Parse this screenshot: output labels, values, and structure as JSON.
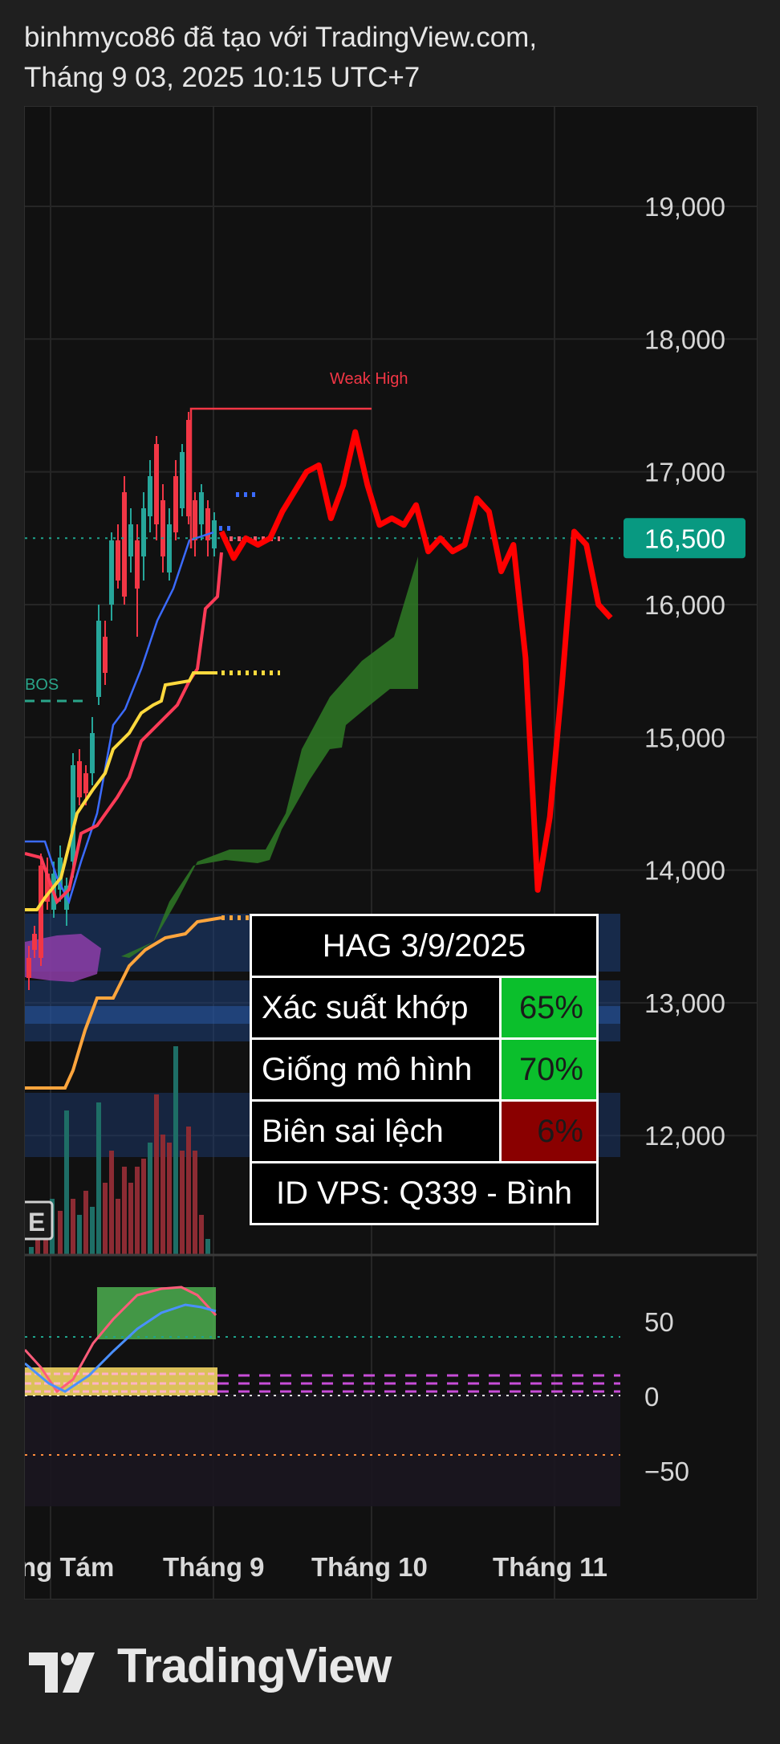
{
  "header": {
    "line1": "binhmyco86 đã tạo với TradingView.com,",
    "line2": "Tháng 9 03, 2025 10:15 UTC+7"
  },
  "chart_data": {
    "type": "line",
    "price_axis": {
      "ticks": [
        "19,000",
        "18,000",
        "17,000",
        "16,000",
        "15,000",
        "14,000",
        "13,000",
        "12,000"
      ],
      "ylim": [
        11100,
        19750
      ]
    },
    "current_price": {
      "label": "16,500",
      "value": 16500,
      "color": "#089981"
    },
    "x_axis": {
      "ticks": [
        "ng Tám",
        "Tháng 9",
        "Tháng 10",
        "Tháng 11"
      ]
    },
    "oscillator_axis": {
      "ticks": [
        "50",
        "0",
        "−50"
      ]
    },
    "annotations": {
      "weak_high": "Weak High",
      "bos": "BOS",
      "badge": "E"
    },
    "projection": {
      "color": "#ff0000",
      "values": [
        16550,
        16350,
        16500,
        16450,
        16500,
        16700,
        16850,
        17000,
        17050,
        16650,
        16900,
        17300,
        16900,
        16600,
        16650,
        16600,
        16750,
        16400,
        16500,
        16400,
        16450,
        16800,
        16700,
        16250,
        16450,
        15600,
        13850,
        14400,
        15400,
        16550,
        16450,
        16000,
        15900
      ]
    }
  },
  "info_table": {
    "title": "HAG 3/9/2025",
    "rows": [
      {
        "label": "Xác suất khớp",
        "value": "65%",
        "color": "#0bbf2c"
      },
      {
        "label": "Giống mô hình",
        "value": "70%",
        "color": "#0bbf2c"
      },
      {
        "label": "Biên sai lệch",
        "value": "6%",
        "color": "#8a0000"
      }
    ],
    "footer": "ID VPS: Q339 - Bình"
  },
  "brand": {
    "name": "TradingView"
  }
}
